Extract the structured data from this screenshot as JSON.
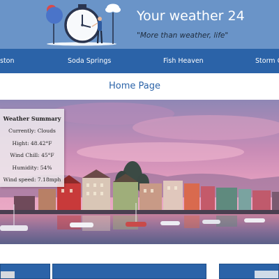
{
  "header": {
    "title": "Your weather 24",
    "tagline": "\"More than weather, life\""
  },
  "nav": {
    "items": [
      {
        "label": "ston"
      },
      {
        "label": "Soda Springs"
      },
      {
        "label": "Fish Heaven"
      },
      {
        "label": "Storm C"
      }
    ]
  },
  "page": {
    "title": "Home Page"
  },
  "weather_summary": {
    "title": "Weather Summary",
    "currently": "Currently: Clouds",
    "high": "Hight: 48.42°F",
    "wind_chill": "Wind Chill: 45°F",
    "humidity": "Humidity: 54%",
    "wind_speed": "Wind speed: 7.18mph"
  },
  "colors": {
    "header_bg": "#6a94c8",
    "nav_bg": "#2b63a8",
    "title_text": "#2b63a8"
  },
  "icons": [
    "clock-person-logo-icon"
  ]
}
